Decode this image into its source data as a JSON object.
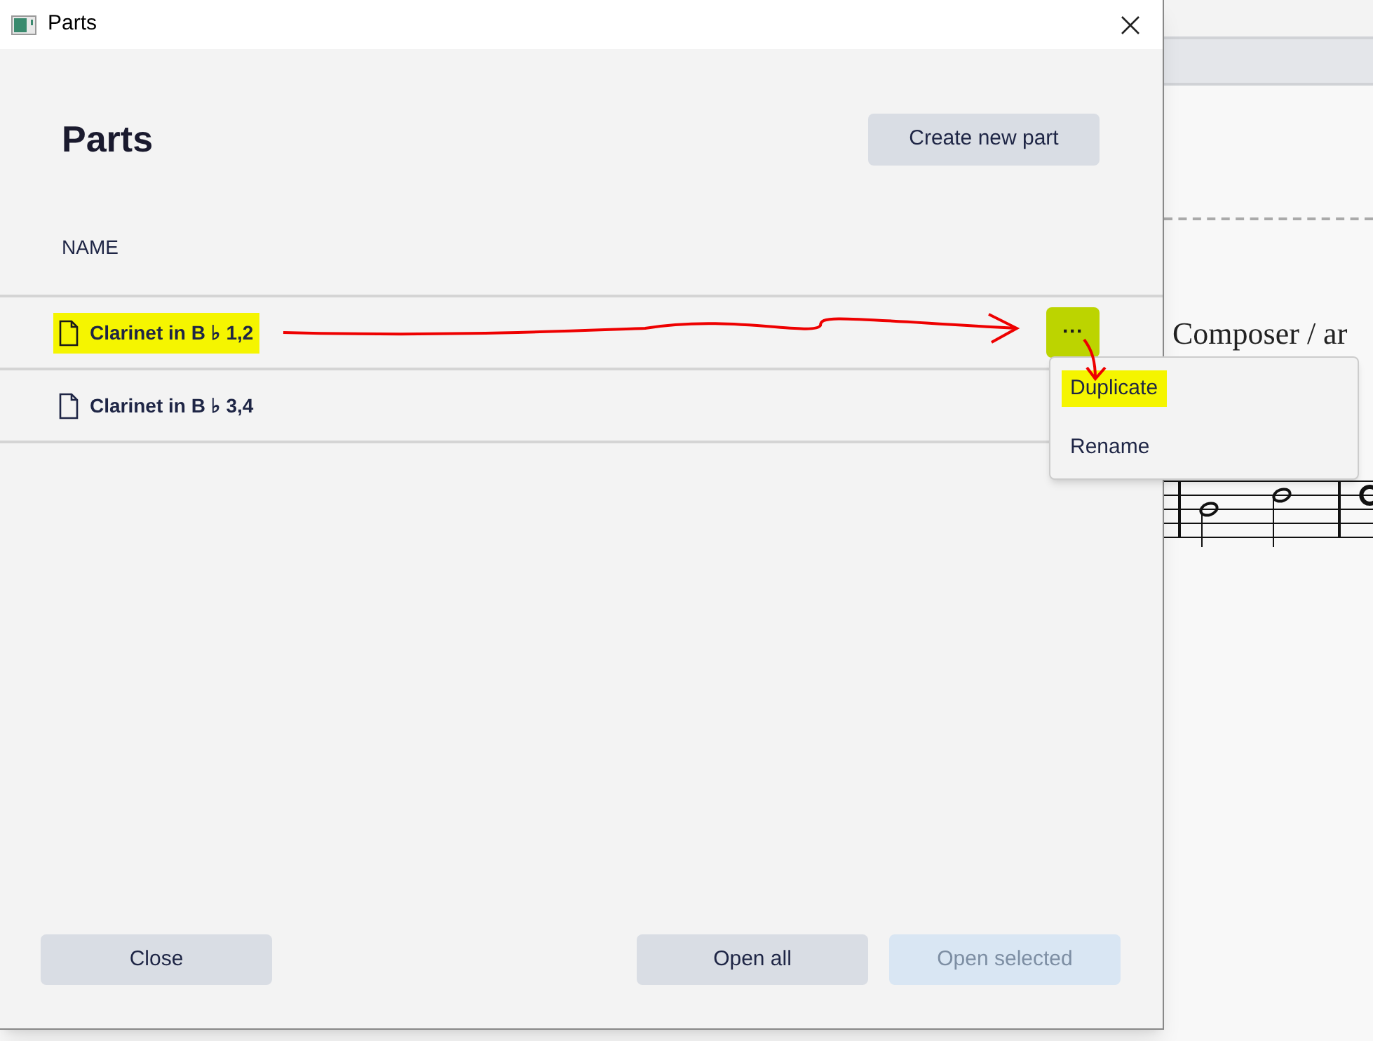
{
  "window": {
    "title": "Parts"
  },
  "heading": "Parts",
  "create_button": "Create new part",
  "column_header": "NAME",
  "parts": [
    {
      "name": "Clarinet in B ♭ 1,2",
      "highlighted": true,
      "menu_button": {
        "label": "···",
        "highlighted": true
      }
    },
    {
      "name": "Clarinet in B ♭ 3,4",
      "highlighted": false
    }
  ],
  "menu": [
    {
      "label": "Duplicate",
      "highlighted": true
    },
    {
      "label": "Rename",
      "highlighted": false
    }
  ],
  "buttons": [
    {
      "label": "Close",
      "disabled": false
    },
    {
      "label": "Open all",
      "disabled": false
    },
    {
      "label": "Open selected",
      "disabled": true
    }
  ],
  "score": {
    "composer_text": "Composer / ar"
  }
}
